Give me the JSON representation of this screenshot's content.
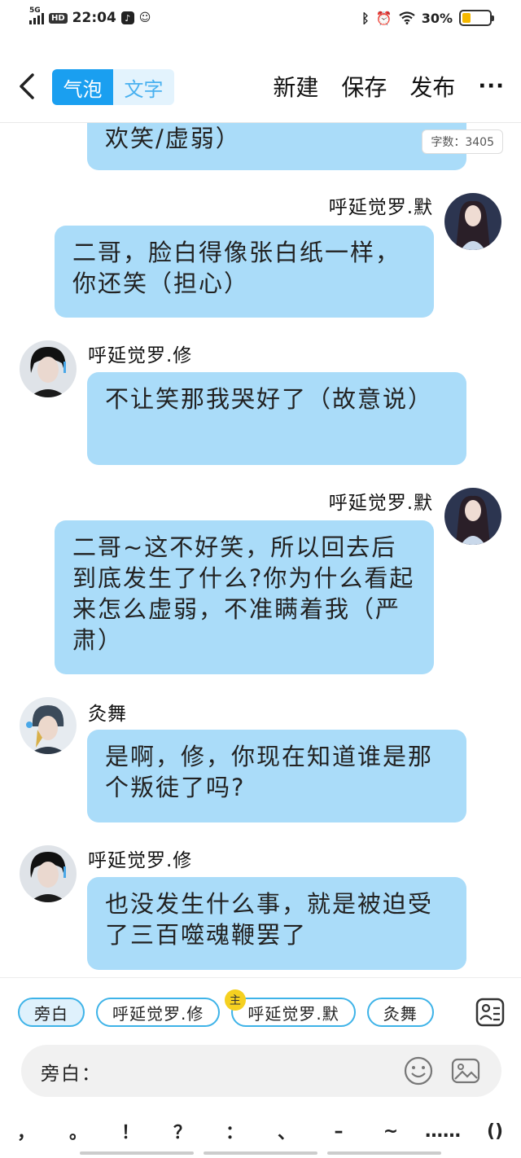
{
  "status_bar": {
    "network": "5G",
    "hd": "HD",
    "time": "22:04",
    "battery_pct": "30%",
    "battery_level": 0.3
  },
  "nav": {
    "tab_bubble": "气泡",
    "tab_text": "文字",
    "new_label": "新建",
    "save_label": "保存",
    "publish_label": "发布",
    "more_label": "···"
  },
  "word_count": "字数：3405",
  "messages": [
    {
      "side": "left",
      "text": "欢笑/虚弱）"
    },
    {
      "side": "right",
      "name": "呼延觉罗.默",
      "text": "二哥，脸白得像张白纸一样，你还笑（担心）"
    },
    {
      "side": "left",
      "name": "呼延觉罗.修",
      "text": "不让笑那我哭好了（故意说）"
    },
    {
      "side": "right",
      "name": "呼延觉罗.默",
      "text": "二哥~这不好笑，所以回去后到底发生了什么?你为什么看起来怎么虚弱，不准瞒着我（严肃）"
    },
    {
      "side": "left",
      "name": "灸舞",
      "text": "是啊，修，你现在知道谁是那个叛徒了吗?"
    },
    {
      "side": "left",
      "name": "呼延觉罗.修",
      "text": "也没发生什么事，就是被迫受了三百噬魂鞭罢了"
    }
  ],
  "roles": [
    "旁白",
    "呼延觉罗.修",
    "呼延觉罗.默",
    "灸舞"
  ],
  "main_badge": "主",
  "input_label": "旁白：",
  "punctuation": [
    "，",
    "。",
    "！",
    "？",
    "：",
    "、",
    "–",
    "~",
    "……",
    "()"
  ],
  "colors": {
    "accent": "#1a9ff0",
    "bubble": "#aadcf9",
    "chip_border": "#3eb3e8",
    "battery": "#f5b800"
  }
}
